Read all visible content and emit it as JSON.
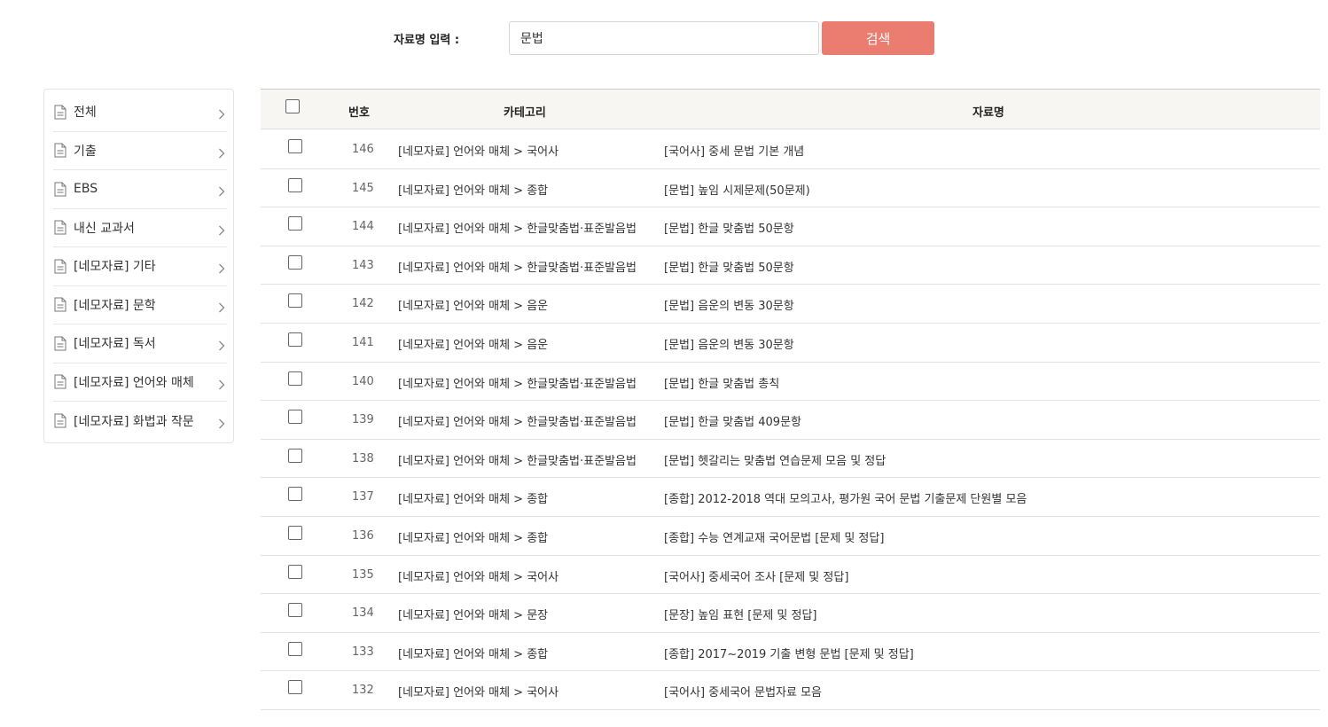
{
  "search": {
    "label": "자료명 입력 :",
    "value": "문법",
    "button_label": "검색"
  },
  "sidebar": {
    "items": [
      {
        "label": "전체"
      },
      {
        "label": "기출"
      },
      {
        "label": "EBS"
      },
      {
        "label": "내신 교과서"
      },
      {
        "label": "[네모자료] 기타"
      },
      {
        "label": "[네모자료] 문학"
      },
      {
        "label": "[네모자료] 독서"
      },
      {
        "label": "[네모자료] 언어와 매체"
      },
      {
        "label": "[네모자료] 화법과 작문"
      }
    ]
  },
  "table": {
    "headers": {
      "number": "번호",
      "category": "카테고리",
      "title": "자료명"
    },
    "rows": [
      {
        "number": "146",
        "category": "[네모자료] 언어와 매체 > 국어사",
        "title": "[국어사] 중세 문법 기본 개념"
      },
      {
        "number": "145",
        "category": "[네모자료] 언어와 매체 > 종합",
        "title": "[문법] 높임 시제문제(50문제)"
      },
      {
        "number": "144",
        "category": "[네모자료] 언어와 매체 > 한글맞춤법·표준발음법",
        "title": "[문법] 한글 맞춤법 50문항"
      },
      {
        "number": "143",
        "category": "[네모자료] 언어와 매체 > 한글맞춤법·표준발음법",
        "title": "[문법] 한글 맞춤법 50문항"
      },
      {
        "number": "142",
        "category": "[네모자료] 언어와 매체 > 음운",
        "title": "[문법] 음운의 변동 30문항"
      },
      {
        "number": "141",
        "category": "[네모자료] 언어와 매체 > 음운",
        "title": "[문법] 음운의 변동 30문항"
      },
      {
        "number": "140",
        "category": "[네모자료] 언어와 매체 > 한글맞춤법·표준발음법",
        "title": "[문법] 한글 맞춤법 총칙"
      },
      {
        "number": "139",
        "category": "[네모자료] 언어와 매체 > 한글맞춤법·표준발음법",
        "title": "[문법] 한글 맞춤법 409문항"
      },
      {
        "number": "138",
        "category": "[네모자료] 언어와 매체 > 한글맞춤법·표준발음법",
        "title": "[문법] 헷갈리는 맞춤법 연습문제 모음 및 정답"
      },
      {
        "number": "137",
        "category": "[네모자료] 언어와 매체 > 종합",
        "title": "[종합] 2012-2018 역대 모의고사, 평가원 국어 문법 기출문제 단원별 모음"
      },
      {
        "number": "136",
        "category": "[네모자료] 언어와 매체 > 종합",
        "title": "[종합] 수능 연계교재 국어문법 [문제 및 정답]"
      },
      {
        "number": "135",
        "category": "[네모자료] 언어와 매체 > 국어사",
        "title": "[국어사] 중세국어 조사 [문제 및 정답]"
      },
      {
        "number": "134",
        "category": "[네모자료] 언어와 매체 > 문장",
        "title": "[문장] 높임 표현 [문제 및 정답]"
      },
      {
        "number": "133",
        "category": "[네모자료] 언어와 매체 > 종합",
        "title": "[종합] 2017~2019 기출 변형 문법 [문제 및 정답]"
      },
      {
        "number": "132",
        "category": "[네모자료] 언어와 매체 > 국어사",
        "title": "[국어사] 중세국어 문법자료 모음"
      }
    ]
  },
  "colors": {
    "accent": "#ea7d70",
    "header_bg": "#f8f6f2"
  }
}
